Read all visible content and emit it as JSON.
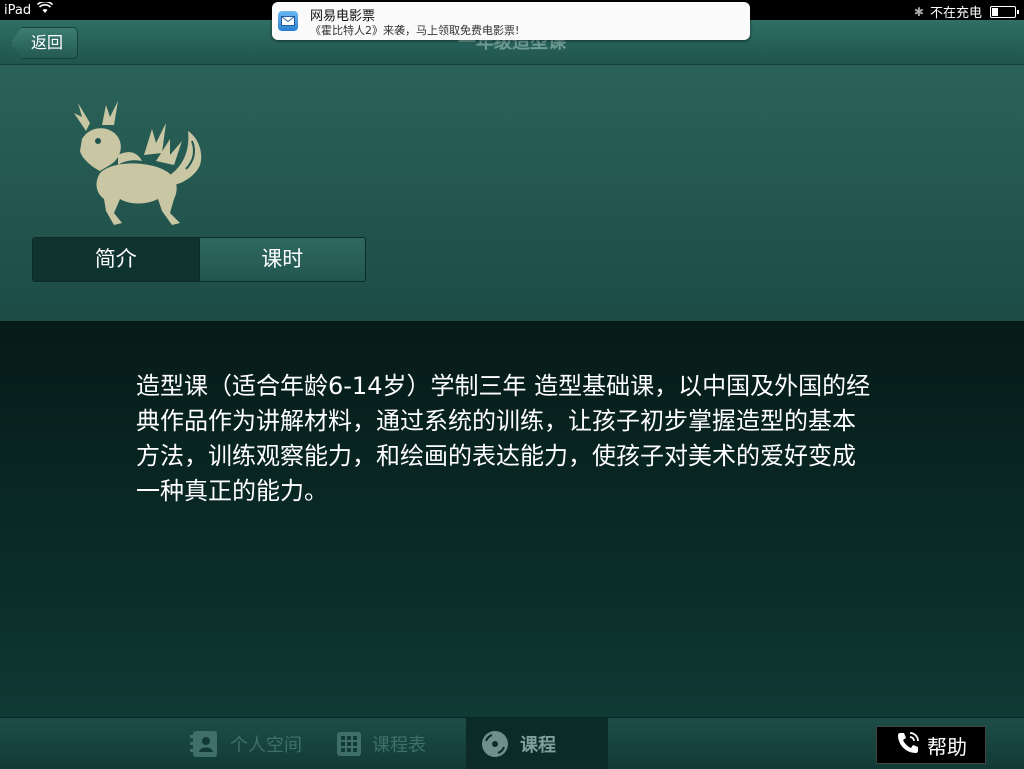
{
  "status_bar": {
    "device": "iPad",
    "charging_status": "不在充电",
    "battery_level": 0.25
  },
  "notification": {
    "app_name": "网易电影票",
    "message": "《霍比特人2》来袭，马上领取免费电影票!"
  },
  "nav": {
    "back_label": "返回",
    "title": "一年级造型课"
  },
  "segments": [
    {
      "label": "简介",
      "active": true
    },
    {
      "label": "课时",
      "active": false
    }
  ],
  "description": "造型课（适合年龄6-14岁）学制三年 造型基础课，以中国及外国的经典作品作为讲解材料，通过系统的训练，让孩子初步掌握造型的基本方法，训练观察能力，和绘画的表达能力，使孩子对美术的爱好变成一种真正的能力。",
  "tabs": [
    {
      "label": "个人空间",
      "icon": "contacts-icon",
      "active": false
    },
    {
      "label": "课程表",
      "icon": "calendar-grid-icon",
      "active": false
    },
    {
      "label": "课程",
      "icon": "disc-icon",
      "active": true
    }
  ],
  "help_label": "帮助",
  "colors": {
    "header_bg": "#2a6259",
    "content_bg": "#061b18",
    "segment_active": "#0f332e",
    "logo_color": "#c9c6a3"
  }
}
